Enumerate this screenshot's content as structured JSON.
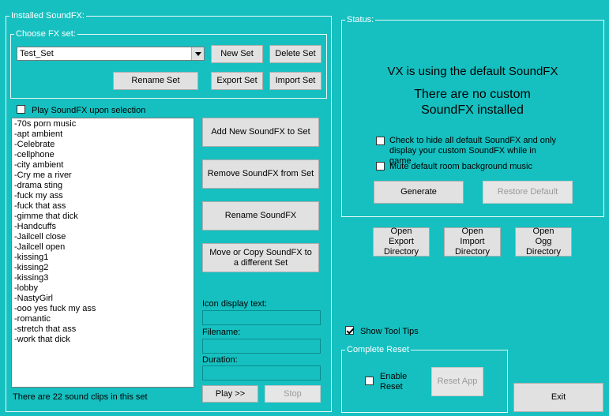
{
  "installed_panel": {
    "title": "Installed SoundFX:",
    "fx_set_group_title": "Choose FX set:",
    "fx_set_selected": "Test_Set",
    "buttons": {
      "new_set": "New Set",
      "delete_set": "Delete Set",
      "rename_set": "Rename Set",
      "export_set": "Export Set",
      "import_set": "Import Set"
    },
    "play_on_select_label": "Play SoundFX upon selection",
    "sound_list": [
      "-70s porn music",
      "-apt ambient",
      "-Celebrate",
      "-cellphone",
      "-city ambient",
      "-Cry me a river",
      "-drama sting",
      "-fuck my ass",
      "-fuck that ass",
      "-gimme that dick",
      "-Handcuffs",
      "-Jailcell close",
      "-Jailcell open",
      "-kissing1",
      "-kissing2",
      "-kissing3",
      "-lobby",
      "-NastyGirl",
      "-ooo yes fuck my ass",
      "-romantic",
      "-stretch that ass",
      "-work that dick"
    ],
    "clip_count_text": "There are 22 sound clips in this set",
    "actions": {
      "add": "Add New SoundFX to Set",
      "remove": "Remove SoundFX from Set",
      "rename": "Rename SoundFX",
      "move_copy": "Move or Copy SoundFX to a different Set"
    },
    "fields": {
      "icon_text_label": "Icon display text:",
      "filename_label": "Filename:",
      "duration_label": "Duration:"
    },
    "play_button": "Play >>",
    "stop_button": "Stop"
  },
  "status_panel": {
    "title": "Status:",
    "line1": "VX is using the default SoundFX",
    "line2": "There are no custom SoundFX installed",
    "hide_default_label": "Check to hide all default SoundFX and only display your custom SoundFX while in game",
    "mute_bg_label": "Mute default room background music",
    "generate": "Generate",
    "restore_default": "Restore Default"
  },
  "directory_buttons": {
    "export": "Open Export Directory",
    "import": "Open Import Directory",
    "ogg": "Open Ogg Directory"
  },
  "show_tool_tips_label": "Show Tool Tips",
  "complete_reset": {
    "title": "Complete Reset",
    "enable_reset_label": "Enable Reset",
    "reset_app": "Reset App"
  },
  "exit_button": "Exit"
}
